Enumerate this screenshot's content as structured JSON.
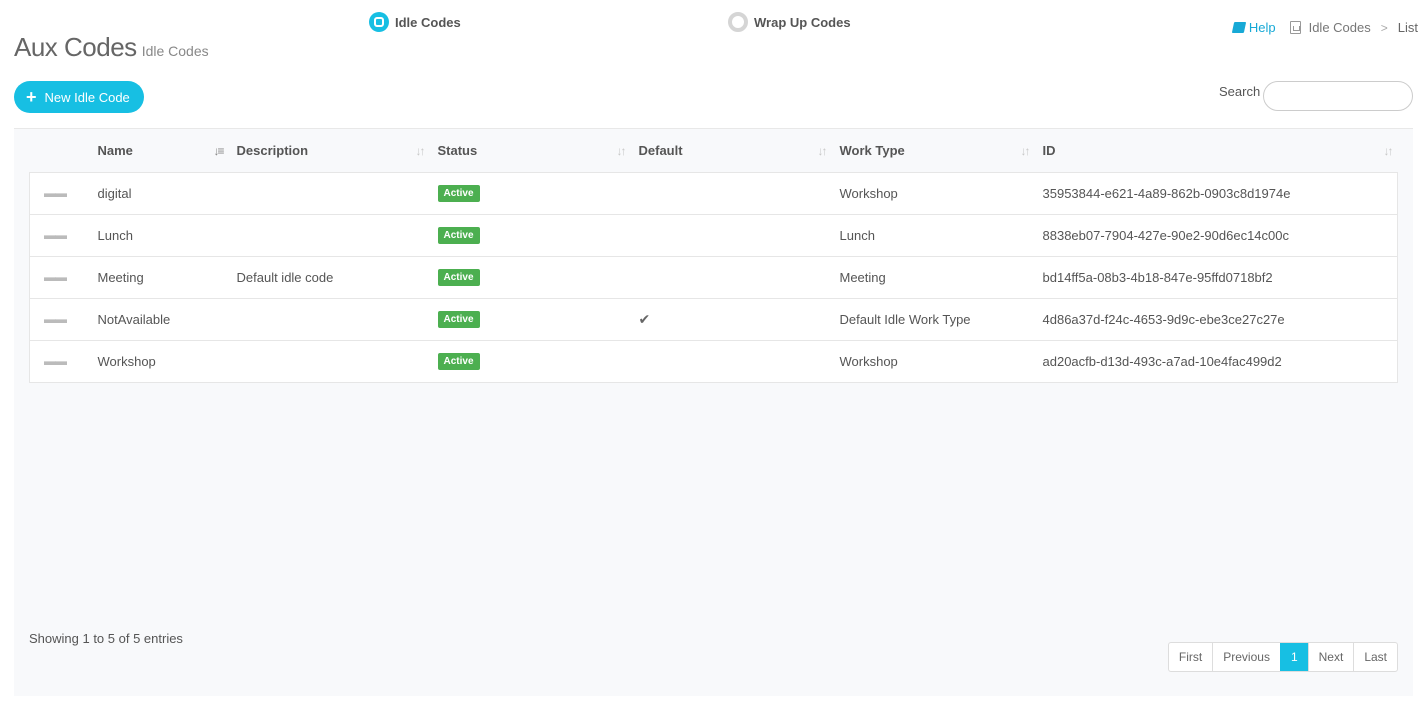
{
  "header": {
    "title": "Aux Codes",
    "subtitle": "Idle Codes"
  },
  "tabs": [
    {
      "label": "Idle Codes",
      "selected": true
    },
    {
      "label": "Wrap Up Codes",
      "selected": false
    }
  ],
  "breadcrumb": {
    "help": "Help",
    "section": "Idle Codes",
    "separator": ">",
    "current": "List"
  },
  "toolbar": {
    "new_button": "New Idle Code",
    "search_label": "Search",
    "search_value": ""
  },
  "table": {
    "columns": [
      "Name",
      "Description",
      "Status",
      "Default",
      "Work Type",
      "ID"
    ],
    "rows": [
      {
        "name": "digital",
        "description": "",
        "status": "Active",
        "default": "",
        "work_type": "Workshop",
        "id": "35953844-e621-4a89-862b-0903c8d1974e"
      },
      {
        "name": "Lunch",
        "description": "",
        "status": "Active",
        "default": "",
        "work_type": "Lunch",
        "id": "8838eb07-7904-427e-90e2-90d6ec14c00c"
      },
      {
        "name": "Meeting",
        "description": "Default idle code",
        "status": "Active",
        "default": "",
        "work_type": "Meeting",
        "id": "bd14ff5a-08b3-4b18-847e-95ffd0718bf2"
      },
      {
        "name": "NotAvailable",
        "description": "",
        "status": "Active",
        "default": "✔",
        "work_type": "Default Idle Work Type",
        "id": "4d86a37d-f24c-4653-9d9c-ebe3ce27c27e"
      },
      {
        "name": "Workshop",
        "description": "",
        "status": "Active",
        "default": "",
        "work_type": "Workshop",
        "id": "ad20acfb-d13d-493c-a7ad-10e4fac499d2"
      }
    ]
  },
  "footer": {
    "info": "Showing 1 to 5 of 5 entries",
    "pager": {
      "first": "First",
      "previous": "Previous",
      "current": "1",
      "next": "Next",
      "last": "Last"
    }
  },
  "colors": {
    "accent": "#17bfe3",
    "active_badge": "#4caf50"
  }
}
